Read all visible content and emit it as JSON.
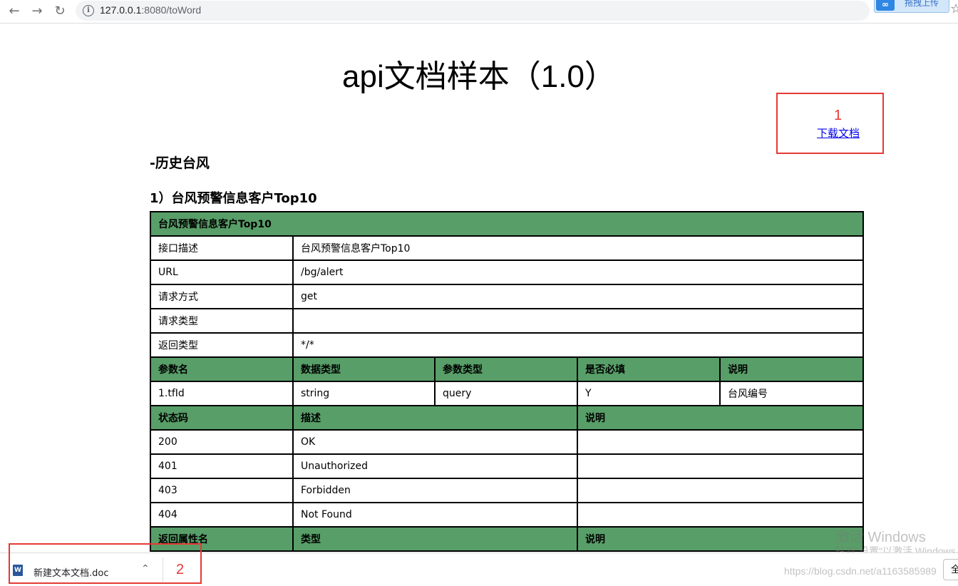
{
  "browser": {
    "url_host": "127.0.0.1",
    "url_path": ":8080/toWord",
    "back_icon": "arrow-left-icon",
    "forward_icon": "arrow-right-icon",
    "reload_icon": "reload-icon",
    "extension_label": "拖拽上传",
    "extension_logo": "∞"
  },
  "page": {
    "title": "api文档样本（1.0）",
    "download_link": "下载文档",
    "section_title": "-历史台风",
    "subsection_title": "1）台风预警信息客户Top10"
  },
  "annotations": {
    "label_1": "1",
    "label_2": "2",
    "color": "#e53935"
  },
  "table": {
    "header_color": "#589e68",
    "caption": "台风预警信息客户Top10",
    "info_rows": [
      {
        "key": "接口描述",
        "value": "台风预警信息客户Top10"
      },
      {
        "key": "URL",
        "value": "/bg/alert"
      },
      {
        "key": "请求方式",
        "value": "get"
      },
      {
        "key": "请求类型",
        "value": ""
      },
      {
        "key": "返回类型",
        "value": "*/*"
      }
    ],
    "param_headers": [
      "参数名",
      "数据类型",
      "参数类型",
      "是否必填",
      "说明"
    ],
    "param_row": [
      "1.tfId",
      "string",
      "query",
      "Y",
      "台风编号"
    ],
    "status_headers": [
      "状态码",
      "描述",
      "说明"
    ],
    "status_rows": [
      [
        "200",
        "OK",
        ""
      ],
      [
        "401",
        "Unauthorized",
        ""
      ],
      [
        "403",
        "Forbidden",
        ""
      ],
      [
        "404",
        "Not Found",
        ""
      ]
    ],
    "return_headers": [
      "返回属性名",
      "类型",
      "说明"
    ]
  },
  "downloads": {
    "file_name": "新建文本文档.doc",
    "file_icon": "W",
    "show_all": "全"
  },
  "watermarks": {
    "windows_line1": "激活 Windows",
    "windows_line2": "转到\"设置\"以激活 Windows。",
    "csdn": "https://blog.csdn.net/a1163585989"
  }
}
